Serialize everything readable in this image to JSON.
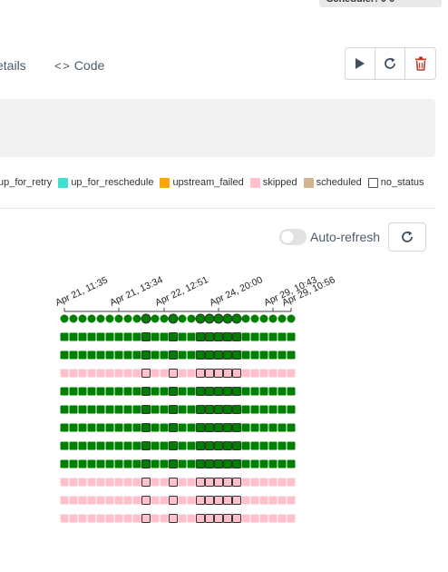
{
  "header": {
    "scheduler_badge": "Scheduler: 0 0"
  },
  "tabs": [
    {
      "label": "etails",
      "icon": "details-icon"
    },
    {
      "label": "Code",
      "icon": "code-icon"
    }
  ],
  "toolbar": {
    "buttons": [
      {
        "icon": "play-icon"
      },
      {
        "icon": "refresh-icon"
      },
      {
        "icon": "trash-icon"
      }
    ]
  },
  "legend": [
    {
      "label": "up_for_retry",
      "color": ""
    },
    {
      "label": "up_for_reschedule",
      "color": "#40e0d0"
    },
    {
      "label": "upstream_failed",
      "color": "#ffa500"
    },
    {
      "label": "skipped",
      "color": "#ffc0cb"
    },
    {
      "label": "scheduled",
      "color": "#d2b48c"
    },
    {
      "label": "no_status",
      "color": "#ffffff"
    }
  ],
  "controls": {
    "auto_refresh_label": "Auto-refresh",
    "auto_refresh_on": false
  },
  "colors": {
    "success": "#008000",
    "skipped": "#ffc0cb",
    "accent_danger": "#c0392b",
    "text_muted": "#4a5a6a"
  },
  "grid": {
    "date_labels": [
      "Apr 21, 11:35",
      "Apr 21, 13:34",
      "Apr 22, 12:51",
      "Apr 24, 20:00",
      "Apr 29, 10:43",
      "Apr 29, 10:56"
    ],
    "date_label_columns": [
      0,
      6,
      11,
      17,
      23,
      29
    ],
    "columns": 26,
    "highlighted_columns": [
      9,
      12,
      15,
      16,
      17,
      18,
      19
    ],
    "rows": [
      "run",
      "success",
      "success",
      "skipped",
      "success",
      "success",
      "success",
      "success",
      "success",
      "skipped",
      "skipped",
      "skipped"
    ]
  }
}
